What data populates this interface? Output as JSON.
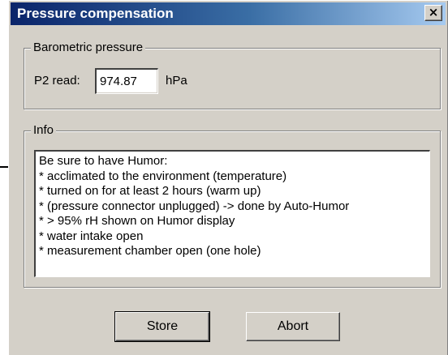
{
  "window": {
    "title": "Pressure compensation",
    "close_label": "×"
  },
  "barometric": {
    "group_label": "Barometric pressure",
    "field_label": "P2 read:",
    "value": "974.87",
    "unit": "hPa"
  },
  "info": {
    "group_label": "Info",
    "lines": [
      "Be sure to have Humor:",
      "* acclimated to the environment (temperature)",
      "* turned on for at least 2 hours (warm up)",
      "* (pressure connector unplugged) -> done by Auto-Humor",
      "* > 95% rH shown on Humor display",
      "* water intake open",
      "* measurement chamber open (one hole)"
    ]
  },
  "buttons": {
    "store": "Store",
    "abort": "Abort"
  },
  "colors": {
    "title_gradient_start": "#0a246a",
    "title_gradient_end": "#a6caf0",
    "dialog_face": "#d4d0c8"
  }
}
